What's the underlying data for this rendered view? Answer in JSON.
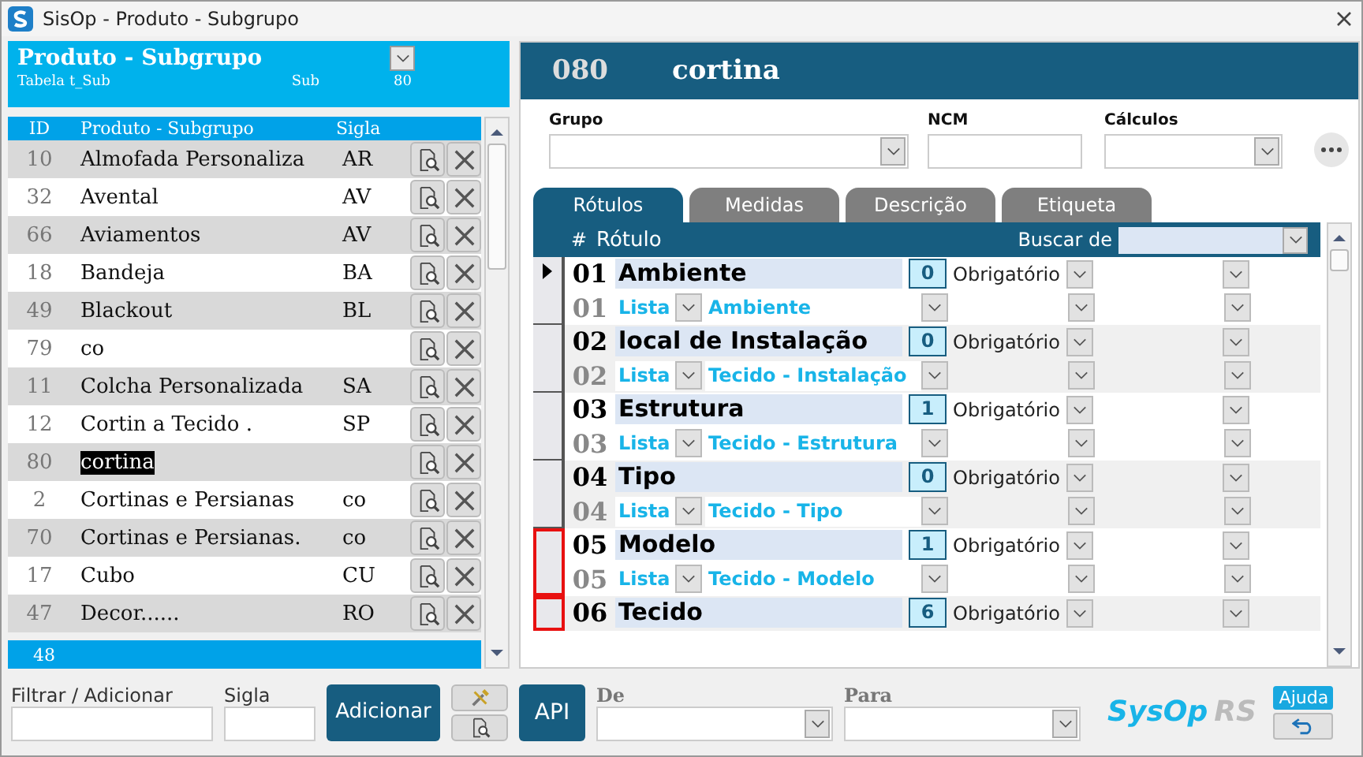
{
  "window": {
    "title": "SisOp - Produto - Subgrupo"
  },
  "list_panel": {
    "title": "Produto - Subgrupo",
    "table_label": "Tabela",
    "table_name": "t_Sub",
    "sub_label": "Sub",
    "sub_value": "80",
    "columns": [
      "ID",
      "Produto - Subgrupo",
      "Sigla"
    ],
    "rows": [
      {
        "id": "10",
        "name": "Almofada Personaliza",
        "sigla": "AR",
        "selected": false
      },
      {
        "id": "32",
        "name": "Avental",
        "sigla": "AV",
        "selected": false
      },
      {
        "id": "66",
        "name": "Aviamentos",
        "sigla": "AV",
        "selected": false
      },
      {
        "id": "18",
        "name": "Bandeja",
        "sigla": "BA",
        "selected": false
      },
      {
        "id": "49",
        "name": "Blackout",
        "sigla": "BL",
        "selected": false
      },
      {
        "id": "79",
        "name": "co",
        "sigla": "",
        "selected": false
      },
      {
        "id": "11",
        "name": "Colcha Personalizada",
        "sigla": "SA",
        "selected": false
      },
      {
        "id": "12",
        "name": "Cortin a Tecido .",
        "sigla": "SP",
        "selected": false
      },
      {
        "id": "80",
        "name": "cortina",
        "sigla": "",
        "selected": true
      },
      {
        "id": "2",
        "name": "Cortinas e Persianas",
        "sigla": "co",
        "selected": false
      },
      {
        "id": "70",
        "name": "Cortinas e Persianas.",
        "sigla": "co",
        "selected": false
      },
      {
        "id": "17",
        "name": "Cubo",
        "sigla": "CU",
        "selected": false
      },
      {
        "id": "47",
        "name": "Decor......",
        "sigla": "RO",
        "selected": false
      }
    ],
    "count": "48"
  },
  "filter": {
    "label": "Filtrar / Adicionar",
    "sigla_label": "Sigla",
    "add_button": "Adicionar"
  },
  "detail": {
    "code": "080",
    "name": "cortina",
    "fields": [
      {
        "label": "Grupo",
        "kind": "combo"
      },
      {
        "label": "NCM",
        "kind": "text"
      },
      {
        "label": "Cálculos",
        "kind": "combo"
      }
    ],
    "tabs": [
      {
        "label": "Rótulos",
        "selected": true
      },
      {
        "label": "Medidas",
        "selected": false
      },
      {
        "label": "Descrição",
        "selected": false
      },
      {
        "label": "Etiqueta",
        "selected": false
      }
    ],
    "grid": {
      "hash": "#",
      "label_header": "Rótulo",
      "search_label": "Buscar de",
      "rows": [
        {
          "num": "01",
          "label": "Ambiente",
          "count": "0",
          "status": "Obrigatório",
          "current": true,
          "highlighted": false,
          "sub": {
            "num": "01",
            "type": "Lista",
            "source": "Ambiente"
          }
        },
        {
          "num": "02",
          "label": "local de Instalação",
          "count": "0",
          "status": "Obrigatório",
          "current": false,
          "highlighted": false,
          "sub": {
            "num": "02",
            "type": "Lista",
            "source": "Tecido - Instalação"
          }
        },
        {
          "num": "03",
          "label": "Estrutura",
          "count": "1",
          "status": "Obrigatório",
          "current": false,
          "highlighted": false,
          "sub": {
            "num": "03",
            "type": "Lista",
            "source": "Tecido - Estrutura"
          }
        },
        {
          "num": "04",
          "label": "Tipo",
          "count": "0",
          "status": "Obrigatório",
          "current": false,
          "highlighted": false,
          "sub": {
            "num": "04",
            "type": "Lista",
            "source": "Tecido - Tipo"
          }
        },
        {
          "num": "05",
          "label": "Modelo",
          "count": "1",
          "status": "Obrigatório",
          "current": false,
          "highlighted": true,
          "sub": {
            "num": "05",
            "type": "Lista",
            "source": "Tecido - Modelo"
          }
        },
        {
          "num": "06",
          "label": "Tecido",
          "count": "6",
          "status": "Obrigatório",
          "current": false,
          "highlighted": true
        }
      ]
    }
  },
  "bottom": {
    "api_button": "API",
    "from_label": "De",
    "to_label": "Para",
    "logo_main": "SysOp",
    "logo_suffix": "RS",
    "help_button": "Ajuda"
  }
}
